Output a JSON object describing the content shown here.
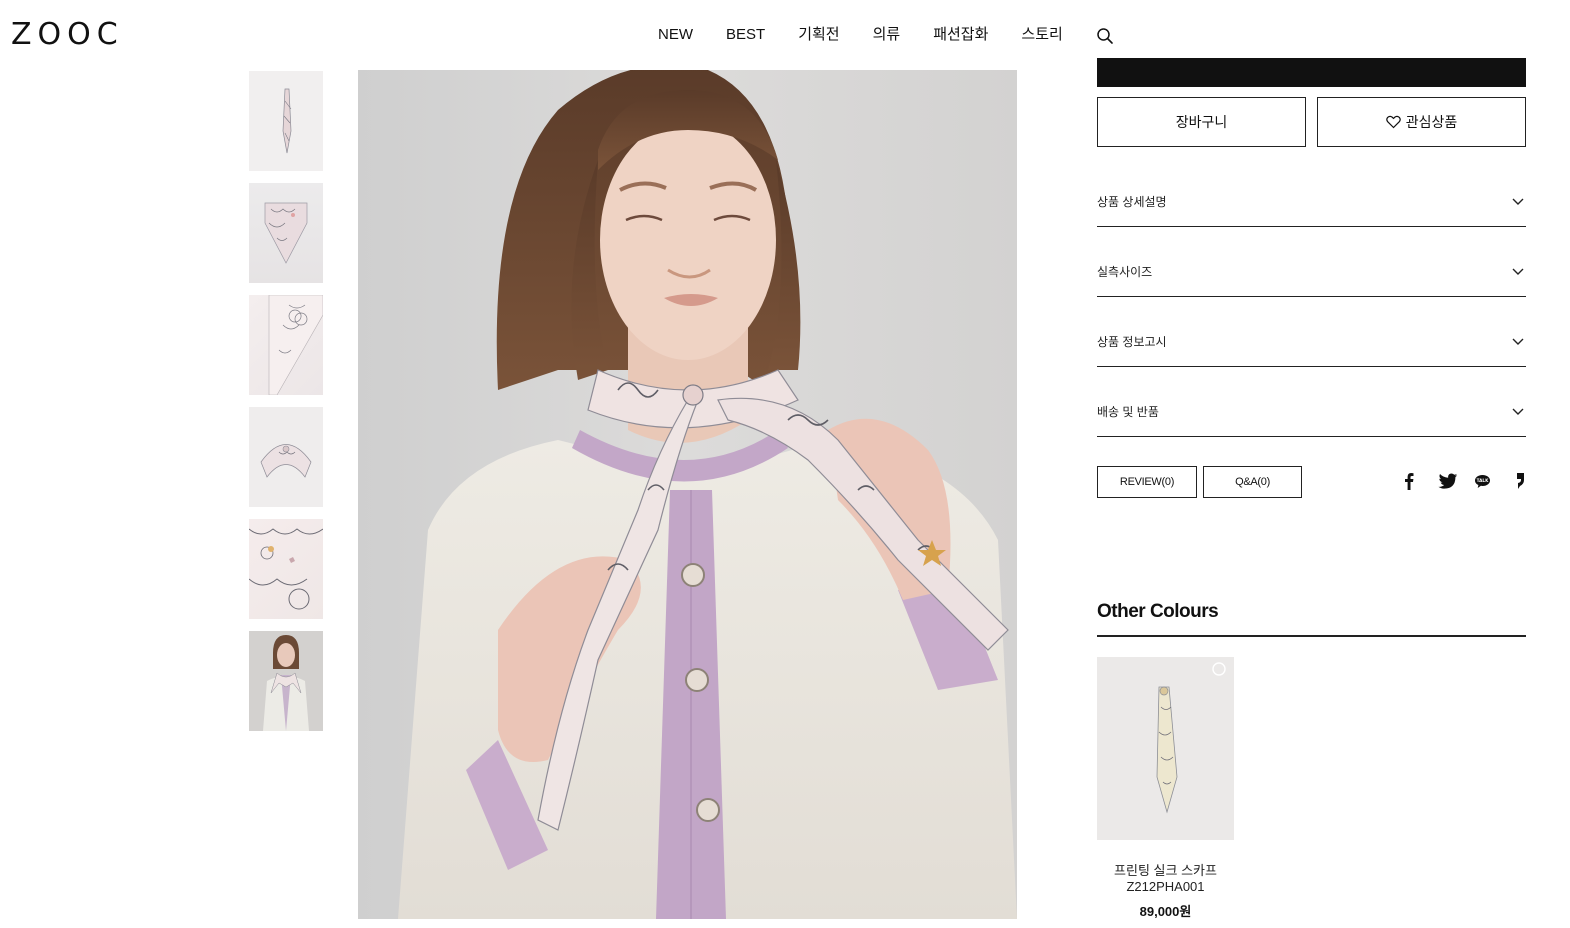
{
  "header": {
    "logo": "ZOOC",
    "nav": [
      "NEW",
      "BEST",
      "기획전",
      "의류",
      "패션잡화",
      "스토리"
    ],
    "search_icon": "search-icon"
  },
  "gallery": {
    "thumbnails": [
      "scarf-flat",
      "scarf-folded",
      "scarf-detail",
      "scarf-knotted",
      "print-closeup",
      "model-wearing"
    ],
    "main_image": "model-wearing-scarf"
  },
  "actions": {
    "cart_label": "장바구니",
    "wish_label": "관심상품"
  },
  "accordions": [
    "상품 상세설명",
    "실측사이즈",
    "상품 정보고시",
    "배송 및 반품"
  ],
  "tabs": {
    "review": "REVIEW(0)",
    "qa": "Q&A(0)"
  },
  "share_icons": [
    "facebook-icon",
    "twitter-icon",
    "kakaotalk-icon",
    "kakaostory-icon"
  ],
  "other_colours": {
    "title": "Other Colours",
    "items": [
      {
        "name": "프린팅 실크 스카프",
        "code": "Z212PHA001",
        "price": "89,000원"
      }
    ]
  }
}
